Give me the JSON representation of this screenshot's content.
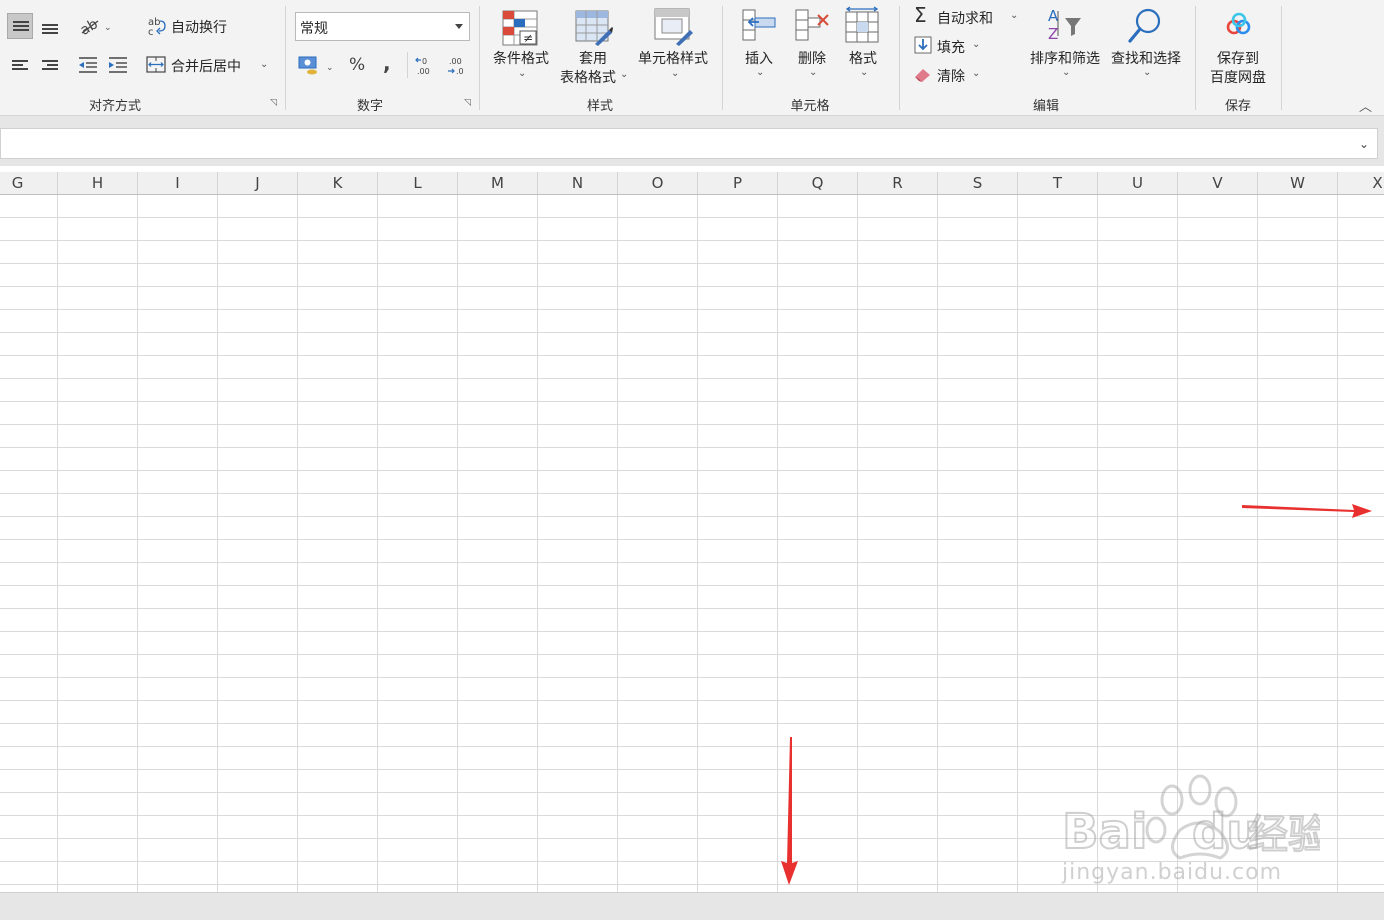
{
  "ribbon": {
    "alignment": {
      "wrap_text": "自动换行",
      "merge_center": "合并后居中",
      "group": "对齐方式"
    },
    "number": {
      "format_value": "常规",
      "percent": "%",
      "comma": ",",
      "inc_decimal": "←0\n.00",
      "group": "数字"
    },
    "styles": {
      "conditional": "条件格式",
      "table_line1": "套用",
      "table_line2": "表格格式",
      "cell_styles": "单元格样式",
      "group": "样式"
    },
    "cells": {
      "insert": "插入",
      "delete": "删除",
      "format": "格式",
      "group": "单元格"
    },
    "editing": {
      "autosum": "自动求和",
      "fill": "填充",
      "clear": "清除",
      "sort_filter": "排序和筛选",
      "find_select": "查找和选择",
      "group": "编辑"
    },
    "save": {
      "line1": "保存到",
      "line2": "百度网盘",
      "group": "保存"
    }
  },
  "columns": [
    "G",
    "H",
    "I",
    "J",
    "K",
    "L",
    "M",
    "N",
    "O",
    "P",
    "Q",
    "R",
    "S",
    "T",
    "U",
    "V",
    "W",
    "X"
  ],
  "watermark": {
    "text": "jingyan.baidu.com",
    "brand": "Bai",
    "brand2": "du",
    "cn": "经验"
  },
  "colors": {
    "arrow": "#e8312f",
    "ribbon_bg": "#f3f3f3",
    "grid_line": "#dadada"
  }
}
